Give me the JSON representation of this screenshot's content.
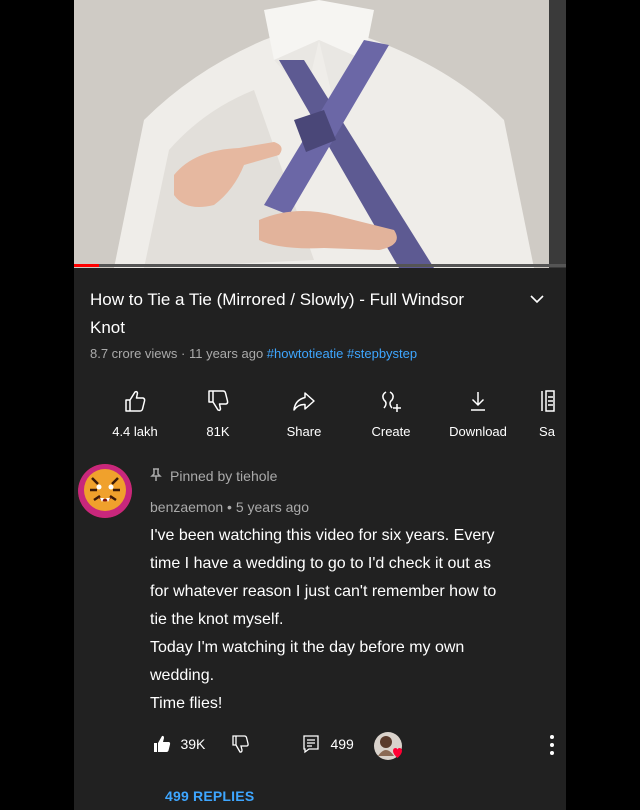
{
  "video": {
    "title": "How to Tie a Tie (Mirrored / Slowly) - Full Windsor Knot",
    "title_line1": "How to Tie a Tie (Mirrored / Slowly) - Full Windsor",
    "title_line2": "Knot",
    "progress_fraction": 0.05,
    "meta_stats": "8.7 crore views · 11 years ago",
    "hashtags": "#howtotieatie #stepbystep"
  },
  "actions": [
    {
      "icon": "thumbs-up-icon",
      "label": "4.4 lakh"
    },
    {
      "icon": "thumbs-down-icon",
      "label": "81K"
    },
    {
      "icon": "share-icon",
      "label": "Share"
    },
    {
      "icon": "create-icon",
      "label": "Create"
    },
    {
      "icon": "download-icon",
      "label": "Download"
    },
    {
      "icon": "save-icon",
      "label": "Sa"
    }
  ],
  "comment": {
    "pinned_label": "Pinned by tiehole",
    "author_line": "benzaemon • 5 years ago",
    "lines": [
      "I've been watching this video for six years. Every",
      "time I have a wedding to go to I'd check it out as",
      "for whatever reason I just can't remember how to",
      "tie the knot myself.",
      "Today I'm watching it the day before my own",
      "wedding.",
      "Time flies!"
    ],
    "likes": "39K",
    "replies_count": "499",
    "replies_link": "499 REPLIES"
  },
  "colors": {
    "background": "#212121",
    "link": "#3ea6ff",
    "secondary_text": "#aaaaaa",
    "progress": "#ff0000"
  }
}
